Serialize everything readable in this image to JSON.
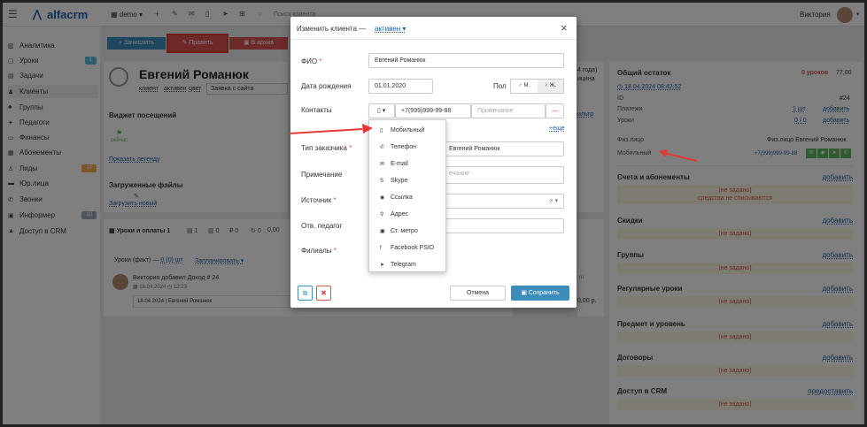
{
  "topbar": {
    "brand": "alfacrm",
    "demo": "demo",
    "search_placeholder": "Поиск клиента",
    "user": "Виктория"
  },
  "sidebar": {
    "items": [
      {
        "label": "Аналитика",
        "icon": "chart-icon"
      },
      {
        "label": "Уроки",
        "icon": "calendar-icon",
        "badge": "1"
      },
      {
        "label": "Задачи",
        "icon": "tasks-icon"
      },
      {
        "label": "Клиенты",
        "icon": "user-icon",
        "active": true
      },
      {
        "label": "Группы",
        "icon": "users-icon"
      },
      {
        "label": "Педагоги",
        "icon": "teacher-icon"
      },
      {
        "label": "Финансы",
        "icon": "money-icon"
      },
      {
        "label": "Абонементы",
        "icon": "ticket-icon"
      },
      {
        "label": "Лиды",
        "icon": "lead-icon",
        "badge": "14"
      },
      {
        "label": "Юр.лица",
        "icon": "building-icon"
      },
      {
        "label": "Звонки",
        "icon": "phone-icon"
      },
      {
        "label": "Информер",
        "icon": "info-icon",
        "badge": "10"
      },
      {
        "label": "Доступ в CRM",
        "icon": "lock-icon"
      }
    ]
  },
  "toolbar": {
    "b1": "Зачислить",
    "b2": "Править",
    "b3": "В архив"
  },
  "client": {
    "name": "Евгений Романюк",
    "tags": [
      "клиент",
      "активен",
      "цвет"
    ],
    "select": "Заявка с сайта",
    "age": "4 года)",
    "age2": "ицина",
    "filter": "ильтр"
  },
  "widget": {
    "title": "Виджет посещений",
    "now": "сейчас",
    "legend": "Показать легенду"
  },
  "files": {
    "title": "Загруженные файлы",
    "upload": "Загрузить новый"
  },
  "tabs": {
    "t1": "Уроки и оплаты 1",
    "t2": "1",
    "t3": "0",
    "t4": "0",
    "t5": "0",
    "t6": "0,00"
  },
  "lessons": {
    "fact": "Уроки (факт) —",
    "fact_link": "0 (0) шт",
    "plan": "Запланировать",
    "event": "Виктория добавил Доход # 24",
    "date": "18.04.2024",
    "time": "12:23",
    "row": "18.04.2024 | Евгений Романюк",
    "amount": "0,00 р.",
    "ru": ".ru"
  },
  "right": {
    "balance_label": "Общий остаток",
    "balance_lessons": "0 уроков",
    "balance_sum": "77,00",
    "date": "18.04.2024 08:42:52",
    "id_label": "ID",
    "id": "#24",
    "pay_label": "Платежи",
    "pay_val": "1 шт",
    "pay_add": "добавить",
    "lessons_label": "Уроки",
    "lessons_val": "0 / 0",
    "lessons_add": "добавить",
    "phys_label": "Физ.лицо",
    "phys_val": "Физ.лицо Евгений Романюк",
    "mobile_label": "Мобильный",
    "mobile_val": "+7(999)999-99-88",
    "sections": [
      {
        "title": "Счета и абонементы",
        "action": "добавить",
        "ns": "(не задано)",
        "extra": "средства не списываются"
      },
      {
        "title": "Скидки",
        "action": "добавить",
        "ns": "(не задано)"
      },
      {
        "title": "Группы",
        "action": "добавить",
        "ns": "(не задано)"
      },
      {
        "title": "Регулярные уроки",
        "action": "добавить",
        "ns": "(не задано)"
      },
      {
        "title": "Предмет и уровень",
        "action": "добавить",
        "ns": "(не задано)"
      },
      {
        "title": "Договоры",
        "action": "добавить",
        "ns": "(не задано)"
      },
      {
        "title": "Доступ в CRM",
        "action": "предоставить",
        "ns": "(не задано)"
      }
    ]
  },
  "modal": {
    "title": "Изменить клиента —",
    "status": "активен",
    "close": "×",
    "fio_label": "ФИО",
    "fio": "Евгений Романюк",
    "dob_label": "Дата рождения",
    "dob": "01.01.2020",
    "sex_label": "Пол",
    "sex_m": "М.",
    "sex_f": "Ж.",
    "contacts_label": "Контакты",
    "phone": "+7(999)999-99-88",
    "note_placeholder": "Примечание",
    "more": "+еще",
    "type_label": "Тип заказчика",
    "type_value": "Евгений Романюк",
    "note_label": "Примечание",
    "note_ph2": "ечание",
    "source_label": "Источник",
    "teacher_label": "Отв. педагог",
    "branch_label": "Филиалы",
    "cancel": "Отмена",
    "save": "Сохранить"
  },
  "dropdown": {
    "items": [
      {
        "label": "Мобильный",
        "icon": "mobile-icon"
      },
      {
        "label": "Телефон",
        "icon": "phone-icon"
      },
      {
        "label": "E-mail",
        "icon": "email-icon"
      },
      {
        "label": "Skype",
        "icon": "skype-icon"
      },
      {
        "label": "Ссылка",
        "icon": "globe-icon"
      },
      {
        "label": "Адрес",
        "icon": "map-pin-icon"
      },
      {
        "label": "Ст. метро",
        "icon": "metro-icon"
      },
      {
        "label": "Facebook PSID",
        "icon": "facebook-icon"
      },
      {
        "label": "Telegram",
        "icon": "telegram-icon"
      }
    ]
  },
  "colors": {
    "accent": "#1f5fa8",
    "danger": "#d9534f",
    "success": "#5cb85c",
    "primary": "#3c8dbc",
    "warn_bg": "#fcf8e3"
  }
}
